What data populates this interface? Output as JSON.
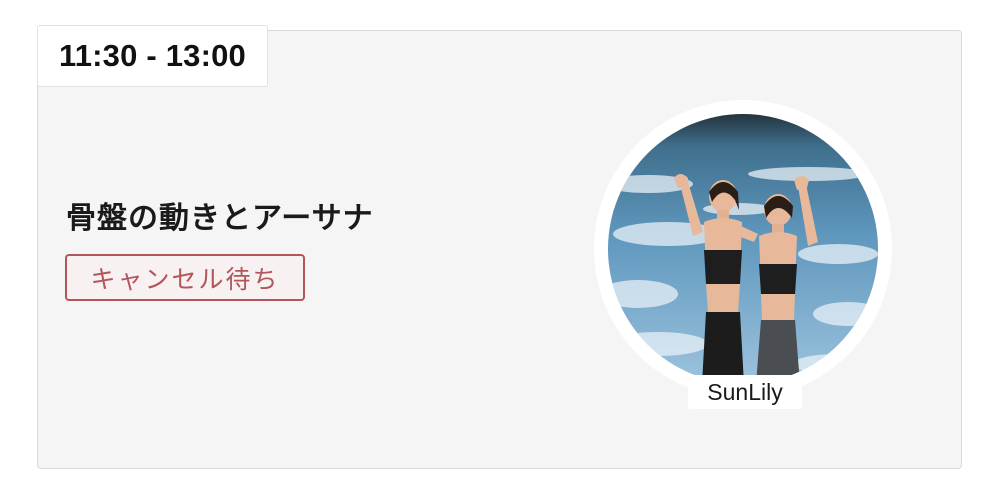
{
  "lesson": {
    "time": "11:30 - 13:00",
    "title": "骨盤の動きとアーサナ",
    "status": "キャンセル待ち",
    "instructor": "SunLily"
  },
  "colors": {
    "card_background": "#f5f5f5",
    "status_accent": "#b2565c",
    "text": "#1a1a1a"
  }
}
